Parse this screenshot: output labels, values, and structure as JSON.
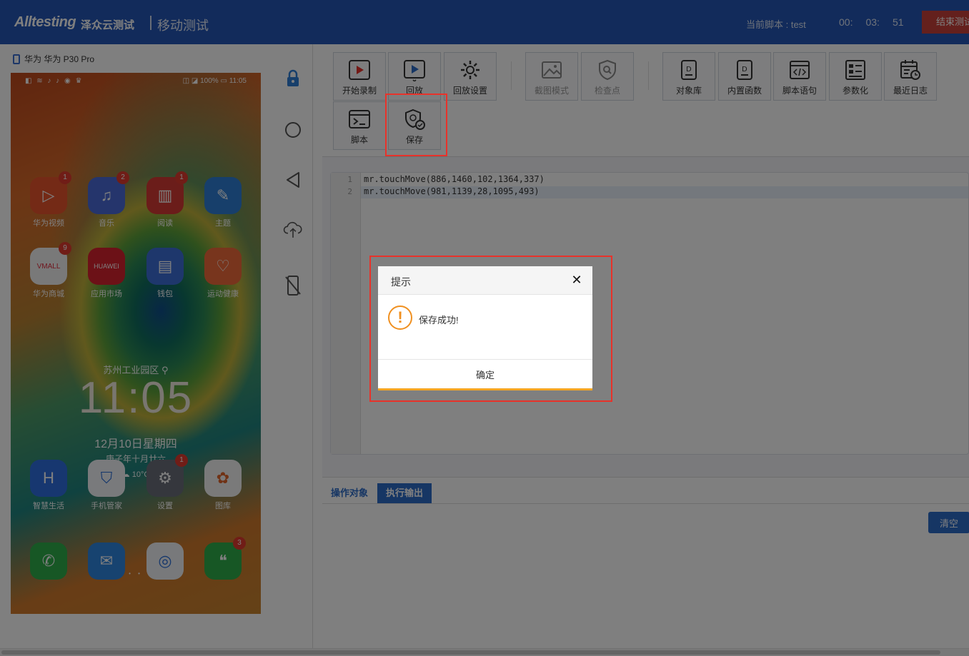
{
  "header": {
    "logo_text": "Alltesting",
    "logo_cn": "泽众云测试",
    "module": "移动测试",
    "current_script_label": "当前脚本 : test",
    "timer": [
      "00:",
      "03:",
      "51"
    ],
    "end_button": "结束测试"
  },
  "device": {
    "title": "华为 华为 P30 Pro",
    "status_left": "◧ ≋ ♪ ♪ ◉ ♛",
    "status_right": "◫ ◪ 100% ▭ 11:05",
    "apps_row1": [
      {
        "label": "华为视频",
        "badge": "1",
        "icon": "video-icon",
        "color": "#e8542d"
      },
      {
        "label": "音乐",
        "badge": "2",
        "icon": "music-icon",
        "color": "#4a6bd8"
      },
      {
        "label": "阅读",
        "badge": "1",
        "icon": "book-icon",
        "color": "#d63b34"
      },
      {
        "label": "主题",
        "badge": "",
        "icon": "brush-icon",
        "color": "#2f7fd6"
      }
    ],
    "apps_row2": [
      {
        "label": "华为商城",
        "badge": "9",
        "icon": "vmall-icon",
        "color": "#e02d3c"
      },
      {
        "label": "应用市场",
        "badge": "",
        "icon": "appgallery-icon",
        "color": "#d8232f"
      },
      {
        "label": "钱包",
        "badge": "",
        "icon": "wallet-icon",
        "color": "#3c6fd8"
      },
      {
        "label": "运动健康",
        "badge": "",
        "icon": "health-icon",
        "color": "#f06a3a"
      }
    ],
    "location": "苏州工业园区 ⚲",
    "clock": "11:05",
    "date": "12月10日星期四",
    "lunar": "庚子年十月廿六",
    "weather": "☁ 10°C",
    "apps_row3": [
      {
        "label": "智慧生活",
        "badge": "",
        "icon": "smart-life-icon",
        "color": "#2e6fe0"
      },
      {
        "label": "手机管家",
        "badge": "",
        "icon": "shield-icon",
        "color": "#f2f4f8"
      },
      {
        "label": "设置",
        "badge": "1",
        "icon": "settings-icon",
        "color": "#6a6f7a"
      },
      {
        "label": "图库",
        "badge": "",
        "icon": "gallery-icon",
        "color": "#f4f4f4"
      }
    ],
    "dock": [
      {
        "label": "",
        "badge": "",
        "icon": "phone-icon",
        "color": "#2eae4a"
      },
      {
        "label": "",
        "badge": "",
        "icon": "messages-icon",
        "color": "#2f86e0"
      },
      {
        "label": "",
        "badge": "",
        "icon": "browser-icon",
        "color": "#f0f2f6"
      },
      {
        "label": "",
        "badge": "3",
        "icon": "wechat-icon",
        "color": "#2eae4a"
      }
    ],
    "page_dots": "• • • • • • • •"
  },
  "toolbar": {
    "record": "开始录制",
    "replay": "回放",
    "replay_settings": "回放设置",
    "screenshot_mode": "截图模式",
    "checkpoint": "检查点",
    "object_library": "对象库",
    "builtin_functions": "内置函数",
    "script_statement": "脚本语句",
    "parameterize": "参数化",
    "recent_logs": "最近日志",
    "script": "脚本",
    "save": "保存"
  },
  "editor": {
    "lines": [
      {
        "num": "1",
        "code": "mr.touchMove(886,1460,102,1364,337)"
      },
      {
        "num": "2",
        "code": "mr.touchMove(981,1139,28,1095,493)"
      }
    ]
  },
  "bottom": {
    "tab_objects": "操作对象",
    "tab_output": "执行输出",
    "clear_button": "清空"
  },
  "modal": {
    "title": "提示",
    "close": "✕",
    "icon": "!",
    "message": "保存成功!",
    "ok_button": "确定"
  },
  "colors": {
    "header_bg": "#2457b6",
    "accent_blue": "#2d6cc9",
    "end_button": "#c8413a",
    "highlight_red": "#e8322a",
    "warning_orange": "#f09020"
  }
}
